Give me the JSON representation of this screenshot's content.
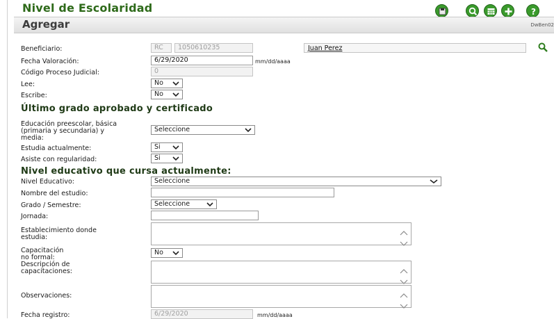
{
  "header": {
    "title": "Nivel de Escolaridad",
    "subtitle": "Agregar",
    "screen_code": "DwBen02"
  },
  "toolbar": {
    "icons": [
      "save-icon",
      "search-icon",
      "calendar-icon",
      "add-icon",
      "help-icon"
    ],
    "accent_color": "#3c9a2a"
  },
  "form": {
    "beneficiario": {
      "label": "Beneficiario:",
      "doc_type": "RC",
      "doc_number": "1050610235",
      "name": "Juan Perez"
    },
    "fecha_valoracion": {
      "label": "Fecha Valoración:",
      "value": "6/29/2020",
      "format": "mm/dd/aaaa"
    },
    "codigo_proceso": {
      "label": "Código Proceso Judicial:",
      "value": "0"
    },
    "lee": {
      "label": "Lee:",
      "value": "No"
    },
    "escribe": {
      "label": "Escribe:",
      "value": "No"
    },
    "section1": "Último grado aprobado y certificado",
    "educacion": {
      "label_line1": "Educación preescolar, básica",
      "label_line2": "(primaria y secundaria) y",
      "label_line3": "media:",
      "value": "Seleccione"
    },
    "estudia": {
      "label": "Estudia actualmente:",
      "value": "Si"
    },
    "asiste": {
      "label": "Asiste con regularidad:",
      "value": "Si"
    },
    "section2": "Nivel educativo que cursa actualmente:",
    "nivel": {
      "label": "Nivel Educativo:",
      "value": "Seleccione"
    },
    "nombre_estudio": {
      "label": "Nombre del estudio:",
      "value": ""
    },
    "grado": {
      "label": "Grado / Semestre:",
      "value": "Seleccione"
    },
    "jornada": {
      "label": "Jornada:",
      "value": ""
    },
    "establecimiento": {
      "label_line1": "Establecimiento donde",
      "label_line2": "estudia:"
    },
    "capacitacion": {
      "label_line1": "Capacitación",
      "label_line2": "no formal:",
      "value": "No"
    },
    "descripcion": {
      "label_line1": "Descripción de",
      "label_line2": "capacitaciones:"
    },
    "observaciones": {
      "label": "Observaciones:"
    },
    "fecha_registro": {
      "label": "Fecha registro:",
      "value": "6/29/2020",
      "format": "mm/dd/aaaa"
    }
  }
}
